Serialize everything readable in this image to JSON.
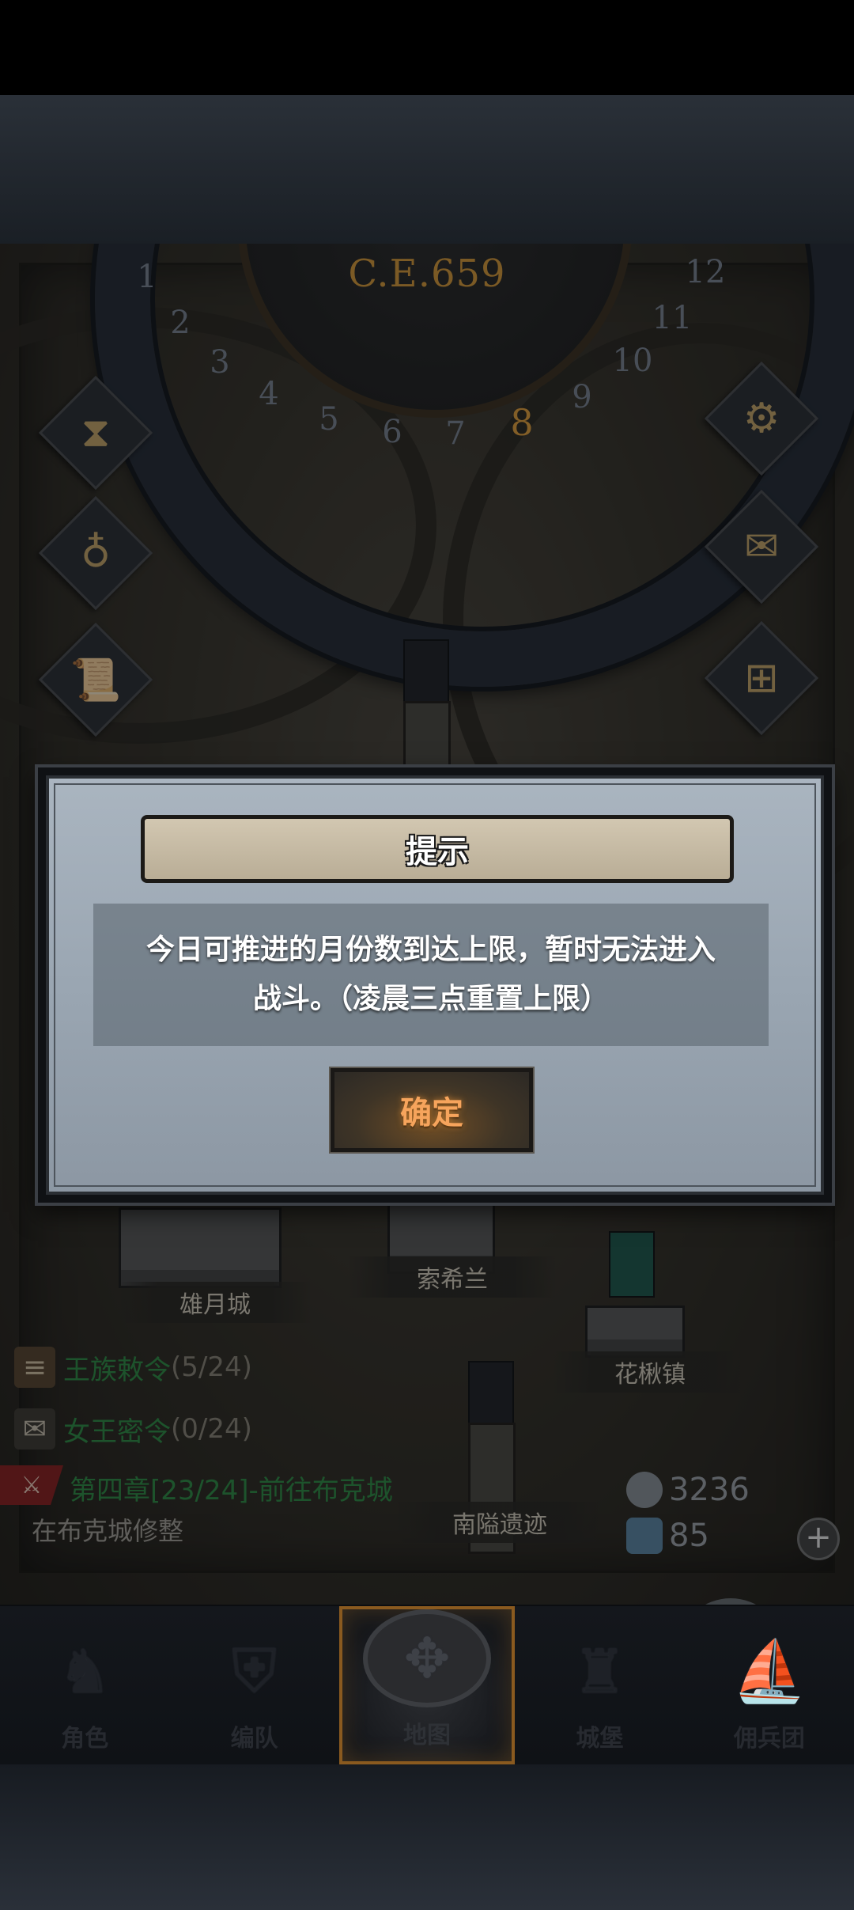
{
  "calendar": {
    "year": "C.E.659",
    "months": [
      "1",
      "2",
      "3",
      "4",
      "5",
      "6",
      "7",
      "8",
      "9",
      "10",
      "11",
      "12"
    ],
    "current_month": "8"
  },
  "map": {
    "places": {
      "xiongyue": "雄月城",
      "suoxilan": "索希兰",
      "huajiao": "花楸镇",
      "ruins": "南隘遗迹"
    }
  },
  "quests": {
    "royal_decree": {
      "label": "王族敕令",
      "count": "(5/24)"
    },
    "queen_order": {
      "label": "女王密令",
      "count": "(0/24)"
    },
    "chapter": "第四章[23/24]-前往布克城",
    "repair": "在布克城修整"
  },
  "resources": {
    "silver": "3236",
    "crystal": "85"
  },
  "dialog": {
    "title": "提示",
    "message_line1": "今日可推进的月份数到达上限，暂时无法进入",
    "message_line2": "战斗。（凌晨三点重置上限）",
    "confirm": "确定"
  },
  "nav": {
    "items": [
      {
        "label": "角色",
        "icon": "knight-icon"
      },
      {
        "label": "编队",
        "icon": "helmet-icon"
      },
      {
        "label": "地图",
        "icon": "compass-map-icon"
      },
      {
        "label": "城堡",
        "icon": "castle-icon"
      },
      {
        "label": "佣兵团",
        "icon": "ship-icon"
      }
    ],
    "active_index": 2
  },
  "colors": {
    "accent_orange": "#e5a23c",
    "quest_green": "#2f8f45",
    "confirm_text": "#f6a45c"
  }
}
